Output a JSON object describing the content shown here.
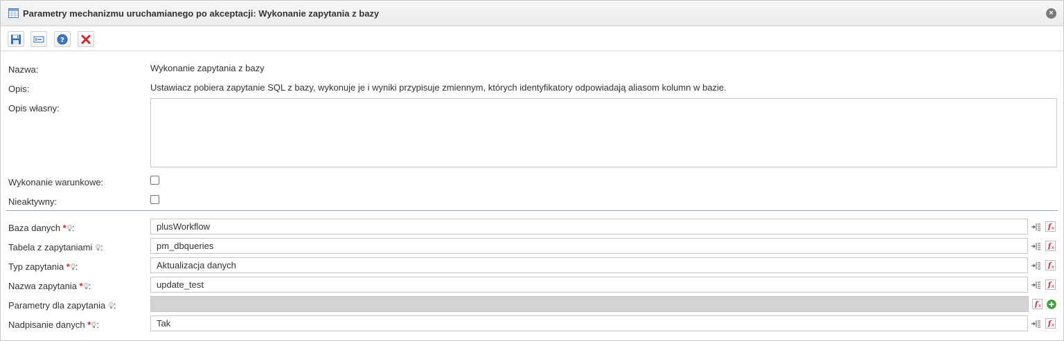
{
  "window": {
    "title": "Parametry mechanizmu uruchamianego po akceptacji: Wykonanie zapytania z bazy",
    "close_glyph": "×"
  },
  "toolbar": {
    "buttons": [
      {
        "icon": "save-icon"
      },
      {
        "icon": "variables-icon"
      },
      {
        "icon": "help-icon"
      },
      {
        "icon": "delete-icon"
      }
    ]
  },
  "info": {
    "name_label": "Nazwa:",
    "name_value": "Wykonanie zapytania z bazy",
    "desc_label": "Opis:",
    "desc_value": "Ustawiacz pobiera zapytanie SQL z bazy, wykonuje je i wyniki przypisuje zmiennym, których identyfikatory odpowiadają aliasom kolumn w bazie.",
    "own_desc_label": "Opis własny:",
    "own_desc_value": "",
    "conditional_label": "Wykonanie warunkowe:",
    "inactive_label": "Nieaktywny:"
  },
  "params": [
    {
      "label": "Baza danych",
      "required": true,
      "value": "plusWorkflow",
      "disabled": false
    },
    {
      "label": "Tabela z zapytaniami",
      "required": false,
      "value": "pm_dbqueries",
      "disabled": false
    },
    {
      "label": "Typ zapytania",
      "required": true,
      "value": "Aktualizacja danych",
      "disabled": false
    },
    {
      "label": "Nazwa zapytania",
      "required": true,
      "value": "update_test",
      "disabled": false
    },
    {
      "label": "Parametry dla zapytania",
      "required": false,
      "value": "",
      "disabled": true
    },
    {
      "label": "Nadpisanie danych",
      "required": true,
      "value": "Tak",
      "disabled": false
    }
  ],
  "colors": {
    "required": "#e02020",
    "disabled_field": "#d3d3d3",
    "delete_red": "#d9202b",
    "add_green": "#3aa935"
  }
}
